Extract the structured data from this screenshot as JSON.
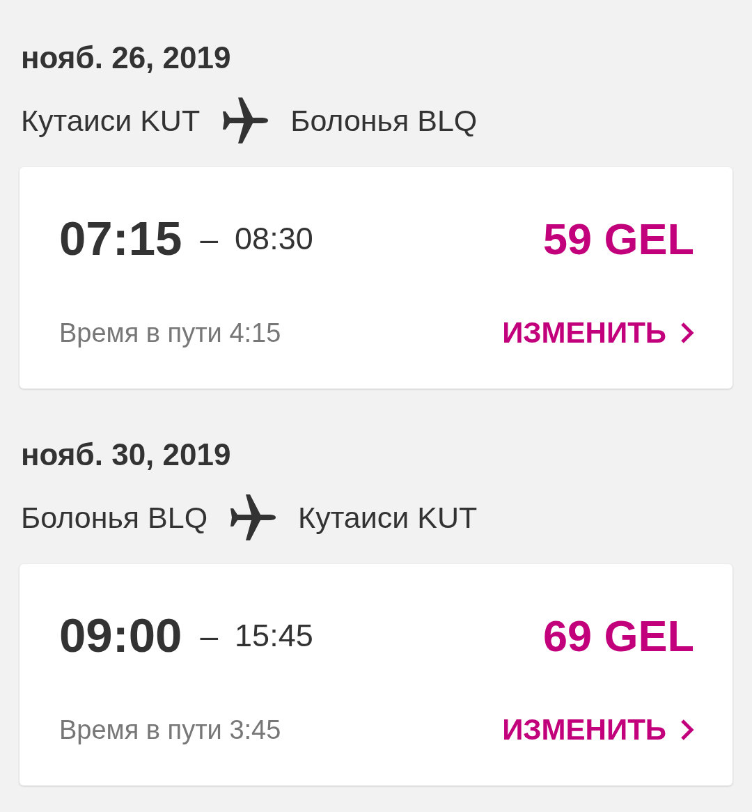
{
  "trips": [
    {
      "date": "нояб. 26, 2019",
      "origin": "Кутаиси KUT",
      "destination": "Болонья BLQ",
      "departure": "07:15",
      "separator": "–",
      "arrival": "08:30",
      "price": "59 GEL",
      "duration": "Время в пути 4:15",
      "action": "ИЗМЕНИТЬ"
    },
    {
      "date": "нояб. 30, 2019",
      "origin": "Болонья BLQ",
      "destination": "Кутаиси KUT",
      "departure": "09:00",
      "separator": "–",
      "arrival": "15:45",
      "price": "69 GEL",
      "duration": "Время в пути 3:45",
      "action": "ИЗМЕНИТЬ"
    }
  ]
}
